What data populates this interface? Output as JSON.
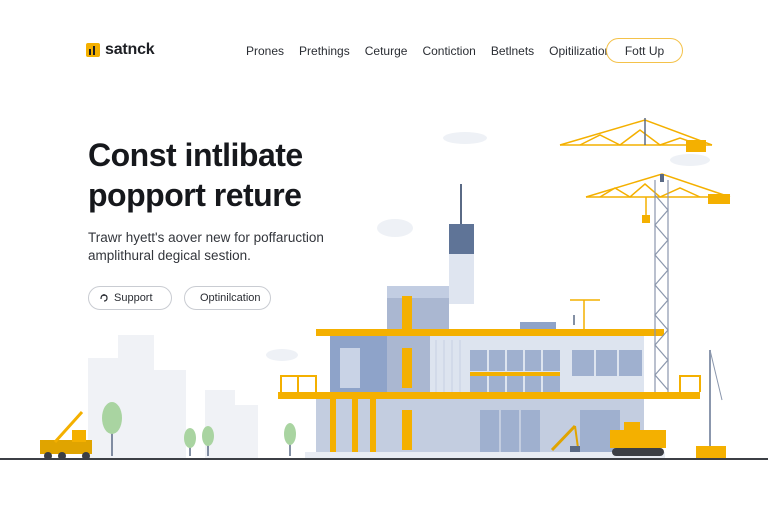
{
  "brand": {
    "name": "satnck"
  },
  "nav": {
    "items": [
      "Prones",
      "Prethings",
      "Ceturge",
      "Contiction",
      "Betlnets",
      "Opitilization"
    ]
  },
  "header": {
    "cta_label": "Fott Up"
  },
  "hero": {
    "title": "Const intlibate popport reture",
    "subtitle": "Trawr hyett's aover new for poffaruction amplithural degical sestion."
  },
  "buttons": {
    "support_label": "Support",
    "optimization_label": "Optinilcation"
  },
  "colors": {
    "accent": "#f4b000",
    "building_blue": "#8ea3c9",
    "building_light": "#c9d3e6",
    "ground": "#3c3f45"
  }
}
